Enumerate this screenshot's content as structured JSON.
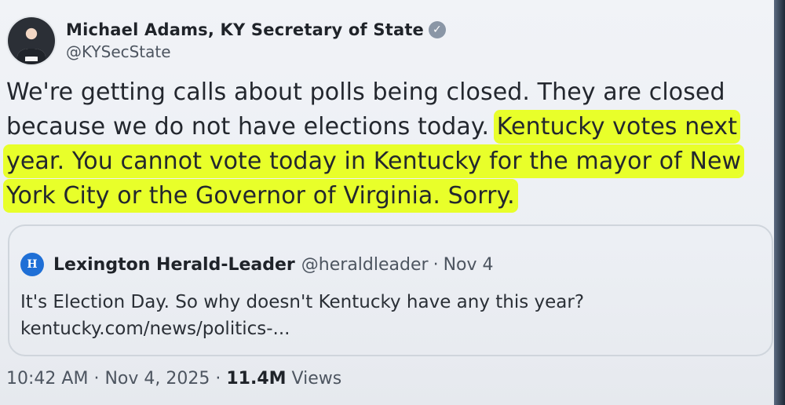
{
  "author": {
    "name": "Michael Adams, KY Secretary of State",
    "handle": "@KYSecState",
    "verified_icon": "verified-badge-icon"
  },
  "tweet": {
    "text_plain": "We're getting calls about polls being closed. They are closed because we do not have elections today.",
    "text_highlighted": "Kentucky votes next year. You cannot vote today in Kentucky for the mayor of New York City or the Governor of Virginia. Sorry."
  },
  "highlight_color": "#e8ff2a",
  "quote": {
    "logo": "H",
    "name": "Lexington Herald-Leader",
    "handle": "@heraldleader",
    "separator": "·",
    "date": "Nov 4",
    "text_line1": "It's Election Day. So why doesn't Kentucky have any this year?",
    "text_line2": "kentucky.com/news/politics-..."
  },
  "footer": {
    "time": "10:42 AM",
    "sep1": "·",
    "date": "Nov 4, 2025",
    "sep2": "·",
    "views_count": "11.4M",
    "views_label": "Views"
  }
}
